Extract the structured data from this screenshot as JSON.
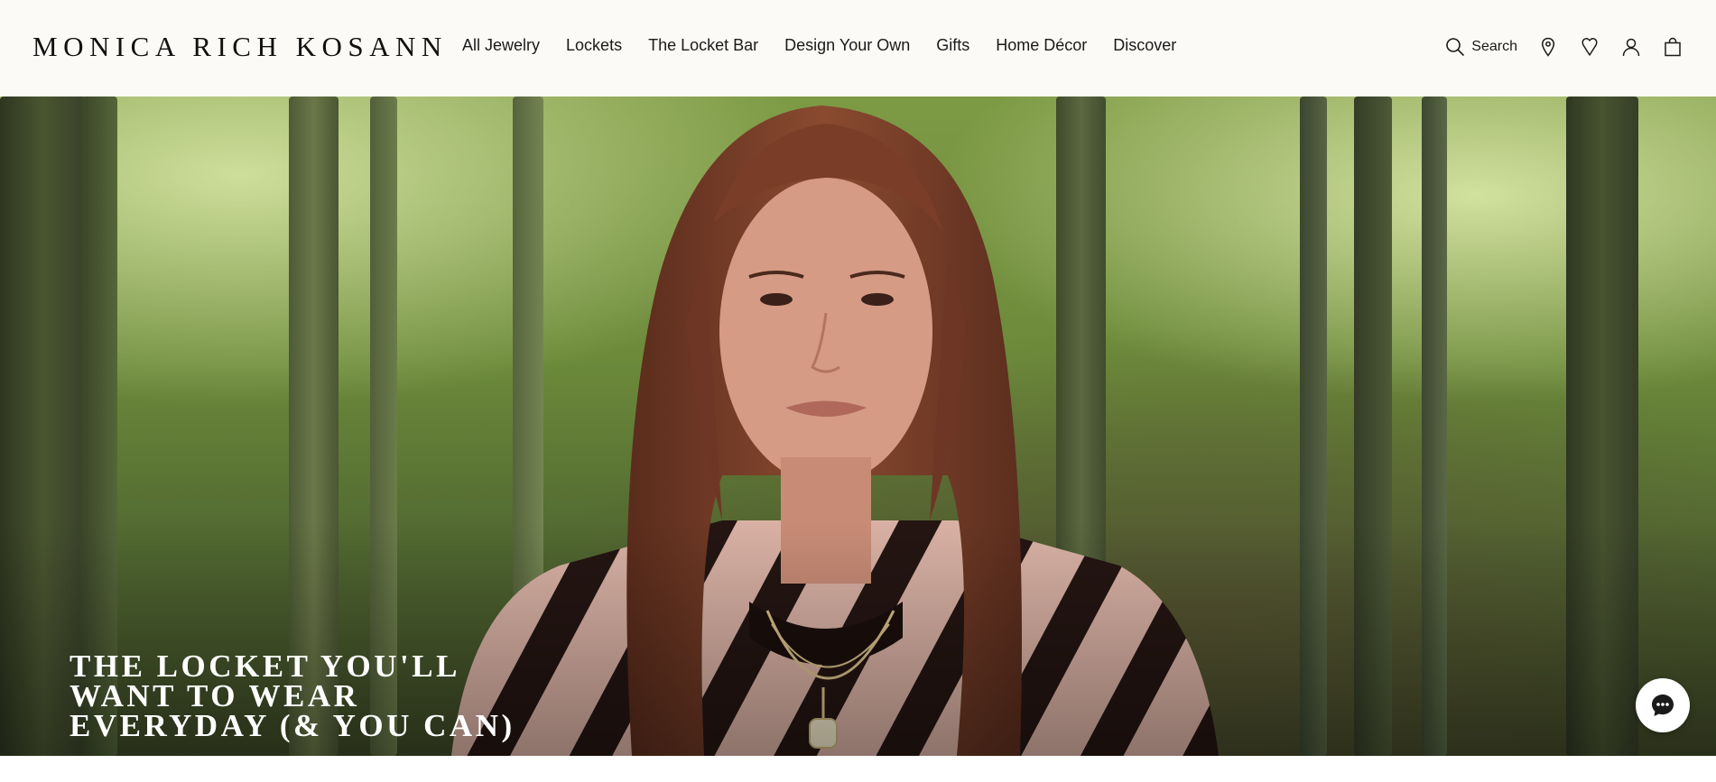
{
  "brand": {
    "logo_text": "MONICA RICH KOSANN"
  },
  "nav": {
    "items": [
      {
        "label": "All Jewelry"
      },
      {
        "label": "Lockets"
      },
      {
        "label": "The Locket Bar"
      },
      {
        "label": "Design Your Own"
      },
      {
        "label": "Gifts"
      },
      {
        "label": "Home Décor"
      },
      {
        "label": "Discover"
      }
    ]
  },
  "tools": {
    "search_label": "Search",
    "icons": [
      "search-icon",
      "location-pin-icon",
      "wishlist-heart-icon",
      "account-icon",
      "shopping-bag-icon"
    ]
  },
  "hero": {
    "headline": "THE LOCKET YOU'LL\nWANT TO WEAR\nEVERYDAY (& YOU CAN)"
  },
  "chat": {
    "icon": "chat-bubble-icon"
  },
  "colors": {
    "header_bg": "#fcfaf6",
    "text": "#1a1a1a",
    "headline_text": "#ffffff"
  }
}
